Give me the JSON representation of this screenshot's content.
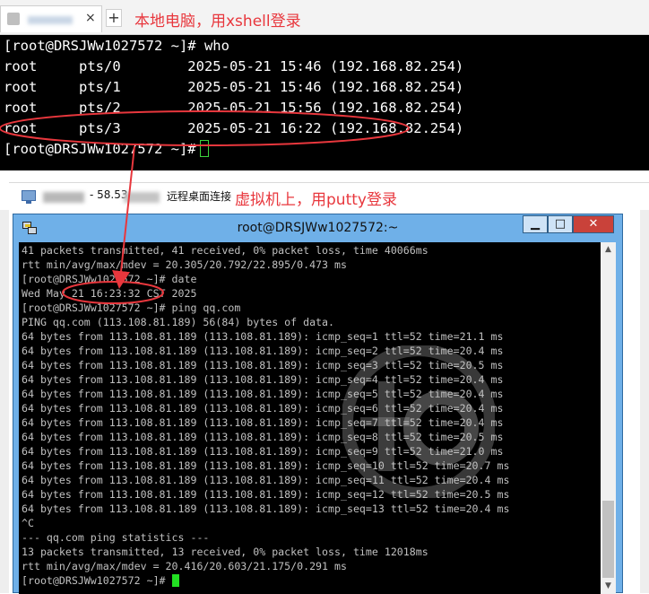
{
  "xshell": {
    "tab_close": "×",
    "new_tab": "+",
    "annotation": "本地电脑，用xshell登录",
    "lines": [
      "[root@DRSJWw1027572 ~]# who",
      "root     pts/0        2025-05-21 15:46 (192.168.82.254)",
      "root     pts/1        2025-05-21 15:46 (192.168.82.254)",
      "root     pts/2        2025-05-21 15:56 (192.168.82.254)",
      "root     pts/3        2025-05-21 16:22 (192.168.82.254)",
      "[root@DRSJWw1027572 ~]#"
    ]
  },
  "rdp": {
    "title_part1": "- 58.53.",
    "title_part2": "远程桌面连接",
    "annotation": "虚拟机上，用putty登录"
  },
  "putty": {
    "title": "root@DRSJWw1027572:~",
    "min_label": "▁",
    "max_label": "□",
    "close_label": "✕",
    "scroll_up": "▲",
    "scroll_down": "▼",
    "lines": [
      "41 packets transmitted, 41 received, 0% packet loss, time 40066ms",
      "rtt min/avg/max/mdev = 20.305/20.792/22.895/0.473 ms",
      "[root@DRSJWw1027572 ~]# date",
      "Wed May 21 16:23:32 CST 2025",
      "[root@DRSJWw1027572 ~]# ping qq.com",
      "PING qq.com (113.108.81.189) 56(84) bytes of data.",
      "64 bytes from 113.108.81.189 (113.108.81.189): icmp_seq=1 ttl=52 time=21.1 ms",
      "64 bytes from 113.108.81.189 (113.108.81.189): icmp_seq=2 ttl=52 time=20.4 ms",
      "64 bytes from 113.108.81.189 (113.108.81.189): icmp_seq=3 ttl=52 time=20.5 ms",
      "64 bytes from 113.108.81.189 (113.108.81.189): icmp_seq=4 ttl=52 time=20.4 ms",
      "64 bytes from 113.108.81.189 (113.108.81.189): icmp_seq=5 ttl=52 time=20.4 ms",
      "64 bytes from 113.108.81.189 (113.108.81.189): icmp_seq=6 ttl=52 time=20.4 ms",
      "64 bytes from 113.108.81.189 (113.108.81.189): icmp_seq=7 ttl=52 time=20.4 ms",
      "64 bytes from 113.108.81.189 (113.108.81.189): icmp_seq=8 ttl=52 time=20.5 ms",
      "64 bytes from 113.108.81.189 (113.108.81.189): icmp_seq=9 ttl=52 time=21.0 ms",
      "64 bytes from 113.108.81.189 (113.108.81.189): icmp_seq=10 ttl=52 time=20.7 ms",
      "64 bytes from 113.108.81.189 (113.108.81.189): icmp_seq=11 ttl=52 time=20.4 ms",
      "64 bytes from 113.108.81.189 (113.108.81.189): icmp_seq=12 ttl=52 time=20.5 ms",
      "64 bytes from 113.108.81.189 (113.108.81.189): icmp_seq=13 ttl=52 time=20.4 ms",
      "^C",
      "--- qq.com ping statistics ---",
      "13 packets transmitted, 13 received, 0% packet loss, time 12018ms",
      "rtt min/avg/max/mdev = 20.416/20.603/21.175/0.291 ms",
      "[root@DRSJWw1027572 ~]#"
    ]
  },
  "colors": {
    "annotation": "#e8373d",
    "cursor": "#22e022",
    "putty_frame": "#6fb0e8"
  }
}
